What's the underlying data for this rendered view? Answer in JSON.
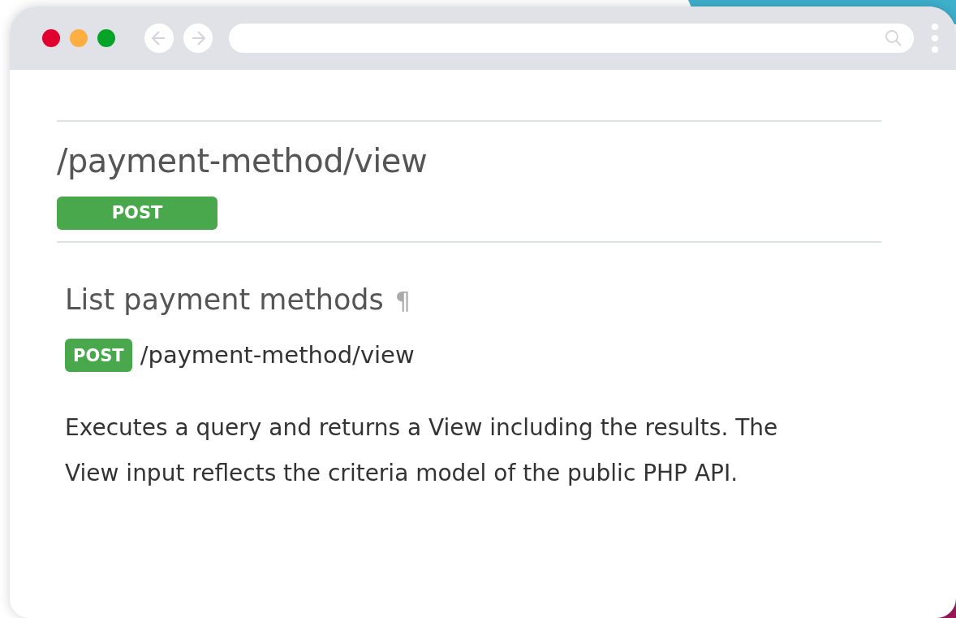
{
  "page": {
    "path_title": "/payment-method/view",
    "method_badge": "POST",
    "operation": {
      "title": "List payment methods",
      "anchor": "¶",
      "method": "POST",
      "path": "/payment-method/view",
      "description": "Executes a query and returns a View including the results. The View input reflects the criteria model of the public PHP API."
    }
  }
}
